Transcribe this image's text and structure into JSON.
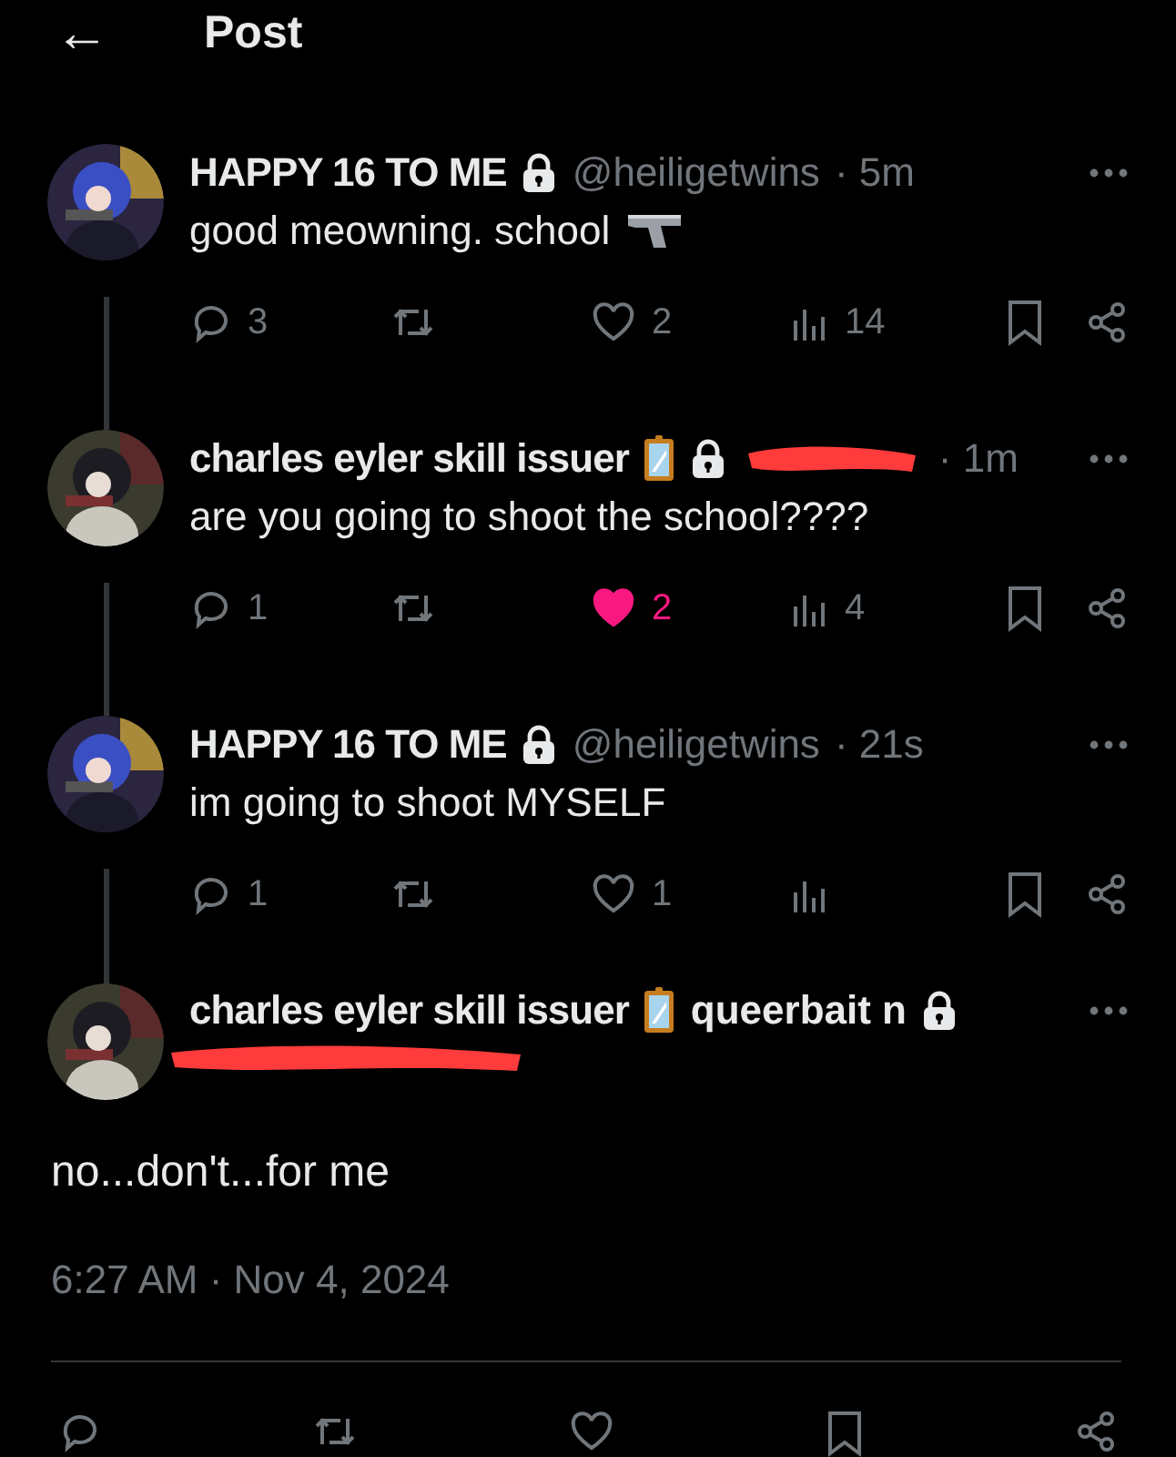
{
  "header": {
    "back": "←",
    "title": "Post"
  },
  "thread": [
    {
      "name": "HAPPY 16 TO ME",
      "badges": [
        {
          "kind": "lock"
        }
      ],
      "handle": "@heiligetwins",
      "time": "· 5m",
      "text": "good meowning. school",
      "trailing_icon": {
        "kind": "pistol"
      },
      "actions": {
        "replies": "3",
        "likes": "2",
        "liked": false,
        "views": "14"
      }
    },
    {
      "name": "charles eyler skill issuer",
      "badges": [
        {
          "kind": "mirror"
        },
        {
          "kind": "lock"
        }
      ],
      "redacted": true,
      "time": "· 1m",
      "text": "are you going to shoot the school????",
      "actions": {
        "replies": "1",
        "likes": "2",
        "liked": true,
        "views": "4"
      }
    },
    {
      "name": "HAPPY 16 TO ME",
      "badges": [
        {
          "kind": "lock"
        }
      ],
      "handle": "@heiligetwins",
      "time": "· 21s",
      "text": "im going to shoot MYSELF",
      "actions": {
        "replies": "1",
        "likes": "1",
        "liked": false
      }
    }
  ],
  "main": {
    "name": "charles eyler skill issuer",
    "name_badge": {
      "kind": "mirror"
    },
    "name_suffix": "queerbait n",
    "suffix_badge": {
      "kind": "lock"
    },
    "handle_redacted": true,
    "text": "no...don't...for me",
    "timestamp": "6:27 AM · Nov 4, 2024"
  }
}
